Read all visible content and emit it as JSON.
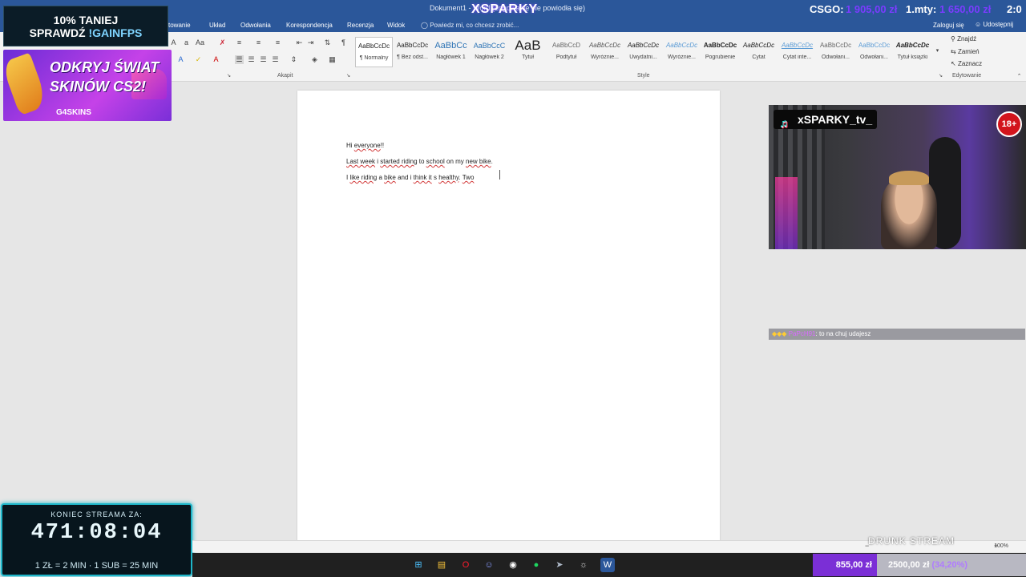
{
  "titlebar": {
    "doc_title": "Dokument1 - Word (Logowanie nie powiodła się)",
    "brand": "XSPARKY",
    "csgo_label": "CSGO:",
    "csgo_value": "1 905,00 zł",
    "rank_label": "1.mty:",
    "rank_value": "1 650,00 zł",
    "time": "2:0"
  },
  "tabs": [
    {
      "label": "ktowanie"
    },
    {
      "label": "Układ"
    },
    {
      "label": "Odwołania"
    },
    {
      "label": "Korespondencja"
    },
    {
      "label": "Recenzja"
    },
    {
      "label": "Widok"
    }
  ],
  "tellme": "Powiedz mi, co chcesz zrobić...",
  "account": {
    "login": "Zaloguj się",
    "share": "Udostępnij"
  },
  "ribbon": {
    "group_paragraph": "Akapit",
    "group_styles": "Style",
    "group_editing": "Edytowanie",
    "styles": [
      {
        "preview": "AaBbCcDc",
        "name": "¶ Normalny"
      },
      {
        "preview": "AaBbCcDc",
        "name": "¶ Bez odst..."
      },
      {
        "preview": "AaBbCc",
        "name": "Nagłówek 1"
      },
      {
        "preview": "AaBbCcC",
        "name": "Nagłówek 2"
      },
      {
        "preview": "AaB",
        "name": "Tytuł"
      },
      {
        "preview": "AaBbCcD",
        "name": "Podtytuł"
      },
      {
        "preview": "AaBbCcDc",
        "name": "Wyróżnie..."
      },
      {
        "preview": "AaBbCcDc",
        "name": "Uwydatni..."
      },
      {
        "preview": "AaBbCcDc",
        "name": "Wyróżnie..."
      },
      {
        "preview": "AaBbCcDc",
        "name": "Pogrubienie"
      },
      {
        "preview": "AaBbCcDc",
        "name": "Cytat"
      },
      {
        "preview": "AaBbCcDc",
        "name": "Cytat inte..."
      },
      {
        "preview": "AaBbCcDc",
        "name": "Odwołani..."
      },
      {
        "preview": "AaBbCcDc",
        "name": "Odwołani..."
      },
      {
        "preview": "AaBbCcDc",
        "name": "Tytuł książki"
      }
    ],
    "edit": {
      "find": "Znajdź",
      "replace": "Zamień",
      "select": "Zaznacz"
    }
  },
  "promo1": {
    "line1": "10% TANIEJ",
    "line2_prefix": "SPRAWDŹ ",
    "line2_code": "!GAINFPS"
  },
  "promo2": {
    "line1": "ODKRYJ ŚWIAT",
    "line2": "SKINÓW CS2!",
    "brand": "G4SKINS"
  },
  "document": {
    "line1": "Hi everyone!!",
    "line2_parts": [
      "Last week",
      " i ",
      "started riding",
      " to ",
      "school",
      " on my ",
      "new bike",
      "."
    ],
    "line3_parts": [
      "I ",
      "like riding",
      " a ",
      "bike",
      " and i ",
      "think it",
      " s ",
      "healthy",
      ". ",
      "Two"
    ]
  },
  "webcam": {
    "handle": "xSPARKY_tv_",
    "age_badge": "18+"
  },
  "chat": {
    "user": "PaPcH91",
    "message": ": to na chuj udajesz"
  },
  "timer": {
    "label": "KONIEC STREAMA ZA:",
    "value": "471:08:04",
    "rates": "1 ZŁ = 2 MIN  ·  1 SUB = 25 MIN"
  },
  "overlay": {
    "drunk": "DRUNK STREAM",
    "bar_left": "855,00 zł",
    "bar_right": "2500,00 zł",
    "bar_pct": "(34,20%)",
    "bar_progress": 0.342
  },
  "statusbar": {
    "zoom": "100%"
  },
  "taskbar": {
    "icons": [
      "windows-icon",
      "folder-icon",
      "opera-icon",
      "discord-icon",
      "obs-icon",
      "spotify-icon",
      "steam-icon",
      "chrome-icon",
      "word-icon"
    ]
  },
  "colors": {
    "word_blue": "#2b579a",
    "accent_purple": "#7b2fd6",
    "timer_cyan": "#1fb6c9"
  }
}
